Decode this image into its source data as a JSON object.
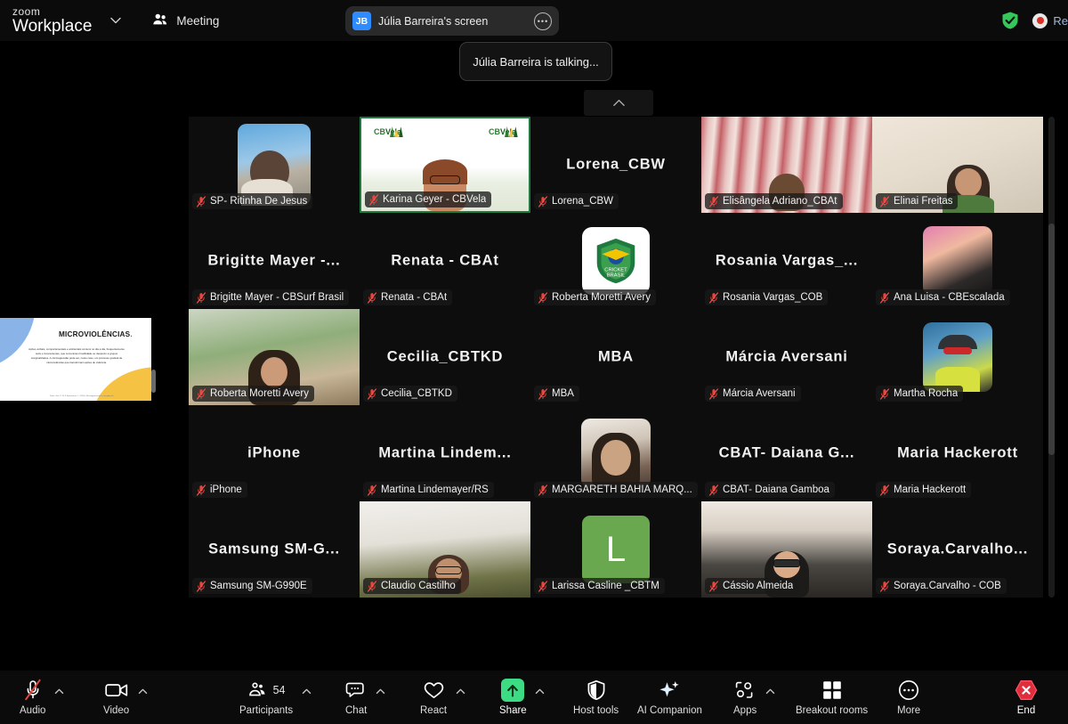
{
  "header": {
    "app_name_line1": "zoom",
    "app_name_line2": "Workplace",
    "dropdown_icon": "chevron-down-icon",
    "meeting_label": "Meeting",
    "meeting_icon": "people-icon",
    "share_pill": {
      "avatar_initials": "JB",
      "label": "Júlia Barreira's screen",
      "more_icon": "ellipsis-icon"
    },
    "security_icon": "shield-check-icon",
    "security_color": "#35c75a",
    "recording_label": "Re",
    "recording_icon": "record-dot-icon"
  },
  "toast": {
    "text": "Júlia Barreira is talking..."
  },
  "gallery_controls": {
    "scroll_up_icon": "chevron-up-icon"
  },
  "shared_screen": {
    "slide_title": "MICROVIOLÊNCIAS",
    "slide_title_punct": ".",
    "slide_body": "Ações verbais, comportamentais e ambientais comuns no dia a dia, frequentemente sutis e inconscientes, que comunicam hostilidade ou desprezo a grupos marginalizados. A microagressão pode ser, neste caso, um processo gradual de microviolências que transformam ações de violência.",
    "slide_footnote": "Fonte: Sue, D. W. & Spanierman, L. (2020). Microaggressions in everyday life.",
    "scrollbar_icon": "vertical-scrollbar"
  },
  "participants": [
    {
      "big_name": "",
      "name": "SP- Ritinha De Jesus",
      "muted": true,
      "type": "video",
      "col": 0,
      "row": 0,
      "active": false
    },
    {
      "big_name": "",
      "name": "Karina Geyer - CBVela",
      "muted": true,
      "type": "video",
      "col": 1,
      "row": 0,
      "active": true
    },
    {
      "big_name": "Lorena_CBW",
      "name": "Lorena_CBW",
      "muted": true,
      "type": "name",
      "col": 2,
      "row": 0,
      "active": false
    },
    {
      "big_name": "",
      "name": "Elisângela Adriano_CBAt",
      "muted": true,
      "type": "video",
      "col": 3,
      "row": 0,
      "active": false
    },
    {
      "big_name": "",
      "name": "Elinai Freitas",
      "muted": true,
      "type": "video",
      "col": 4,
      "row": 0,
      "active": false
    },
    {
      "big_name": "Brigitte Mayer -...",
      "name": "Brigitte Mayer - CBSurf Brasil",
      "muted": true,
      "type": "name",
      "col": 0,
      "row": 1,
      "active": false
    },
    {
      "big_name": "Renata - CBAt",
      "name": "Renata - CBAt",
      "muted": true,
      "type": "name",
      "col": 1,
      "row": 1,
      "active": false
    },
    {
      "big_name": "",
      "name": "Roberta Moretti Avery",
      "muted": true,
      "type": "logo",
      "col": 2,
      "row": 1,
      "active": false
    },
    {
      "big_name": "Rosania Vargas_...",
      "name": "Rosania Vargas_COB",
      "muted": true,
      "type": "name",
      "col": 3,
      "row": 1,
      "active": false
    },
    {
      "big_name": "",
      "name": "Ana Luisa - CBEscalada",
      "muted": true,
      "type": "avatar-photo",
      "col": 4,
      "row": 1,
      "active": false
    },
    {
      "big_name": "",
      "name": "Roberta Moretti Avery",
      "muted": true,
      "type": "video",
      "col": 0,
      "row": 2,
      "active": false
    },
    {
      "big_name": "Cecilia_CBTKD",
      "name": "Cecilia_CBTKD",
      "muted": true,
      "type": "name",
      "col": 1,
      "row": 2,
      "active": false
    },
    {
      "big_name": "MBA",
      "name": "MBA",
      "muted": true,
      "type": "name",
      "col": 2,
      "row": 2,
      "active": false
    },
    {
      "big_name": "Márcia Aversani",
      "name": "Márcia Aversani",
      "muted": true,
      "type": "name",
      "col": 3,
      "row": 2,
      "active": false
    },
    {
      "big_name": "",
      "name": "Martha Rocha",
      "muted": true,
      "type": "avatar-photo",
      "col": 4,
      "row": 2,
      "active": false
    },
    {
      "big_name": "iPhone",
      "name": "iPhone",
      "muted": true,
      "type": "name",
      "col": 0,
      "row": 3,
      "active": false
    },
    {
      "big_name": "Martina Lindem...",
      "name": "Martina Lindemayer/RS",
      "muted": true,
      "type": "name",
      "col": 1,
      "row": 3,
      "active": false
    },
    {
      "big_name": "",
      "name": "MARGARETH BAHIA  MARQ...",
      "muted": true,
      "type": "avatar-photo",
      "col": 2,
      "row": 3,
      "active": false
    },
    {
      "big_name": "CBAT- Daiana G...",
      "name": "CBAT- Daiana Gamboa",
      "muted": true,
      "type": "name",
      "col": 3,
      "row": 3,
      "active": false
    },
    {
      "big_name": "Maria Hackerott",
      "name": "Maria Hackerott",
      "muted": true,
      "type": "name",
      "col": 4,
      "row": 3,
      "active": false
    },
    {
      "big_name": "Samsung SM-G...",
      "name": "Samsung SM-G990E",
      "muted": true,
      "type": "name",
      "col": 0,
      "row": 4,
      "active": false
    },
    {
      "big_name": "",
      "name": "Claudio Castilho",
      "muted": true,
      "type": "video",
      "col": 1,
      "row": 4,
      "active": false
    },
    {
      "big_name": "",
      "name": "Larissa Casline _CBTM",
      "muted": true,
      "type": "letter",
      "letter": "L",
      "col": 2,
      "row": 4,
      "active": false
    },
    {
      "big_name": "",
      "name": "Cássio Almeida",
      "muted": true,
      "type": "video",
      "col": 3,
      "row": 4,
      "active": false
    },
    {
      "big_name": "Soraya.Carvalho...",
      "name": "Soraya.Carvalho - COB",
      "muted": true,
      "type": "name",
      "col": 4,
      "row": 4,
      "active": false
    }
  ],
  "toolbar": [
    {
      "label": "Audio",
      "icon": "microphone-muted-icon",
      "caret": true,
      "badge": "",
      "state": "muted"
    },
    {
      "label": "Video",
      "icon": "camera-icon",
      "caret": true,
      "badge": "",
      "state": "on"
    },
    {
      "label": "Participants",
      "icon": "people-icon",
      "caret": true,
      "badge": "54",
      "state": ""
    },
    {
      "label": "Chat",
      "icon": "chat-bubble-icon",
      "caret": true,
      "badge": "",
      "state": ""
    },
    {
      "label": "React",
      "icon": "heart-icon",
      "caret": true,
      "badge": "",
      "state": ""
    },
    {
      "label": "Share",
      "icon": "share-arrow-up-icon",
      "caret": true,
      "badge": "",
      "state": "active"
    },
    {
      "label": "Host tools",
      "icon": "shield-icon",
      "caret": false,
      "badge": "",
      "state": ""
    },
    {
      "label": "AI Companion",
      "icon": "sparkle-icon",
      "caret": false,
      "badge": "",
      "state": ""
    },
    {
      "label": "Apps",
      "icon": "apps-icon",
      "caret": true,
      "badge": "",
      "state": ""
    },
    {
      "label": "Breakout rooms",
      "icon": "grid-squares-icon",
      "caret": false,
      "badge": "",
      "state": ""
    },
    {
      "label": "More",
      "icon": "ellipsis-circle-icon",
      "caret": false,
      "badge": "",
      "state": ""
    },
    {
      "label": "End",
      "icon": "end-call-icon",
      "caret": false,
      "badge": "",
      "state": "danger"
    }
  ],
  "colors": {
    "background": "#000000",
    "chrome": "#0b0b0b",
    "accent_green": "#3ddc84",
    "danger_red": "#e02d3c",
    "mute_red": "#e8453c",
    "avatar_blue": "#2d8cff",
    "security_green": "#35c75a"
  }
}
